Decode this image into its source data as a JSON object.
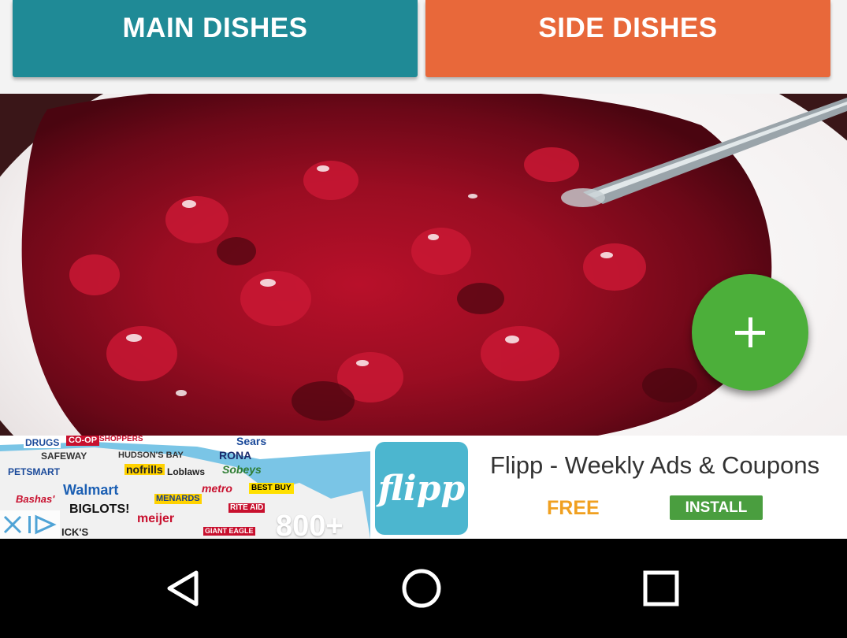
{
  "categories": {
    "main_label": "MAIN DISHES",
    "side_label": "SIDE DISHES"
  },
  "fab": {
    "icon": "plus-icon",
    "color": "#4caf3a"
  },
  "ad": {
    "title": "Flipp - Weekly Ads & Coupons",
    "price": "FREE",
    "install_label": "INSTALL",
    "logo_text": "flipp",
    "promo_number": "800+",
    "stores": [
      "DRUGS",
      "CO-OP",
      "SHOPPERS",
      "Sears",
      "SAFEWAY",
      "HUDSON'S BAY",
      "RONA",
      "PETSMART",
      "nofrills",
      "Loblaws",
      "Sobeys",
      "Walmart",
      "metro",
      "BEST BUY",
      "Bashas'",
      "MENARDS",
      "BIGLOTS!",
      "RITE AID",
      "meijer",
      "ICK'S",
      "GIANT EAGLE"
    ]
  },
  "colors": {
    "main_button": "#1f8a96",
    "side_button": "#e8683a",
    "install": "#4a9e3f",
    "free_text": "#f0a020"
  },
  "nav": {
    "back_icon": "back-triangle-icon",
    "home_icon": "home-circle-icon",
    "recents_icon": "recents-square-icon"
  }
}
